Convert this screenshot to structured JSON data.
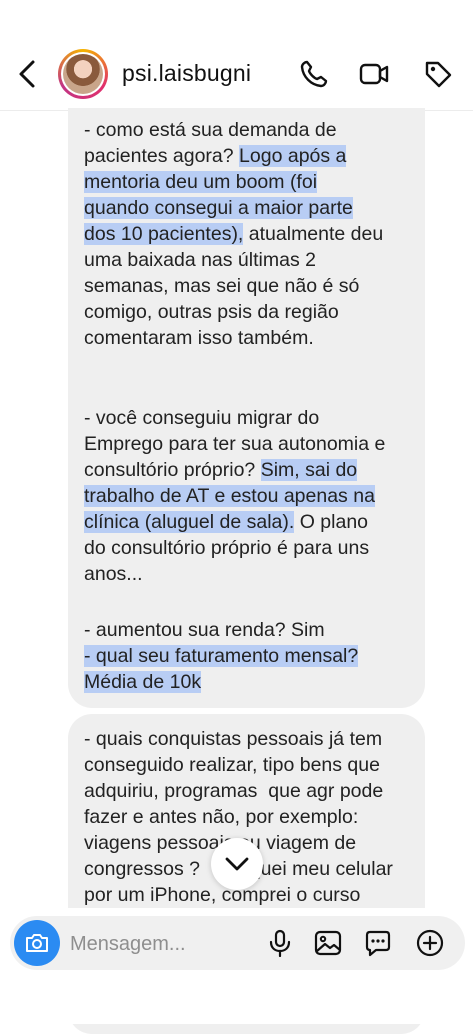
{
  "header": {
    "username": "psi.laisbugni",
    "icons": [
      "back-icon",
      "phone-icon",
      "video-icon",
      "tag-icon"
    ]
  },
  "message1": {
    "q1_a": "- como está sua demanda de",
    "q1_b": "pacientes agora?",
    "q1_c": "Logo após a",
    "q1_d": "mentoria deu um boom (foi",
    "q1_e": "quando consegui a maior parte",
    "q1_f": "dos 10 pacientes),",
    "q1_g": "atualmente deu",
    "q1_h": "uma baixada nas últimas 2",
    "q1_i": "semanas, mas sei que não é só",
    "q1_j": "comigo, outras psis da região",
    "q1_k": "comentaram isso também.",
    "q2_a": "- você conseguiu migrar do",
    "q2_b": "Emprego para ter sua autonomia e",
    "q2_c": "consultório próprio?",
    "q2_d": "Sim, sai do",
    "q2_e": "trabalho de AT e estou apenas na",
    "q2_f": "clínica (aluguel de sala).",
    "q2_g": "O plano",
    "q2_h": "do consultório próprio é para uns",
    "q2_i": "anos...",
    "q3": "- aumentou sua renda? Sim",
    "q4_a": "- qual seu faturamento mensal?",
    "q4_b": "Média de 10k"
  },
  "message2": {
    "line1": "- quais conquistas pessoais já tem",
    "line2": "conseguido realizar, tipo bens que",
    "line3": "adquiriu, programas  que agr pode",
    "line4": "fazer e antes não, por exemplo:",
    "line5": "viagens pessoais ou viagem de",
    "line6": "congressos ?     troquei meu celular",
    "line7": "por um iPhone, comprei o curso"
  },
  "composer": {
    "placeholder": "Mensagem...",
    "icons": [
      "camera-icon",
      "mic-icon",
      "gallery-icon",
      "sticker-icon",
      "plus-icon"
    ]
  },
  "colors": {
    "highlight": "#b8cdf4",
    "bubble": "#efefef",
    "camera_button": "#2b8bf2"
  }
}
